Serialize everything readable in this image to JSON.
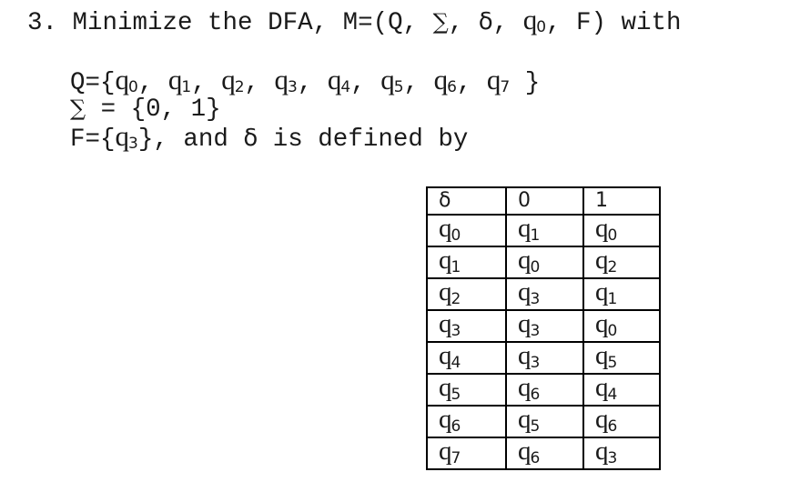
{
  "problem": {
    "number": "3.",
    "title_prefix": "Minimize the DFA, M=(Q, ",
    "sigma_symbol": "∑",
    "title_mid1": ", ",
    "delta_symbol": "δ",
    "title_mid2": ", ",
    "start_state": {
      "base": "q",
      "sub": "0"
    },
    "title_suffix": ", F) with"
  },
  "definitions": {
    "Q_label": "Q={",
    "states": [
      {
        "base": "q",
        "sub": "0"
      },
      {
        "base": "q",
        "sub": "1"
      },
      {
        "base": "q",
        "sub": "2"
      },
      {
        "base": "q",
        "sub": "3"
      },
      {
        "base": "q",
        "sub": "4"
      },
      {
        "base": "q",
        "sub": "5"
      },
      {
        "base": "q",
        "sub": "6"
      },
      {
        "base": "q",
        "sub": "7"
      }
    ],
    "Q_close": " }",
    "sigma_symbol": "∑",
    "sigma_rest": " = {0, 1}",
    "F_label": "F={",
    "final_states": [
      {
        "base": "q",
        "sub": "3"
      }
    ],
    "F_close": "}, and ",
    "delta_symbol": "δ",
    "F_rest": " is defined by"
  },
  "transition_table": {
    "headers": [
      "δ",
      "0",
      "1"
    ],
    "rows": [
      {
        "state": {
          "base": "q",
          "sub": "0"
        },
        "on0": {
          "base": "q",
          "sub": "1"
        },
        "on1": {
          "base": "q",
          "sub": "0"
        }
      },
      {
        "state": {
          "base": "q",
          "sub": "1"
        },
        "on0": {
          "base": "q",
          "sub": "0"
        },
        "on1": {
          "base": "q",
          "sub": "2"
        }
      },
      {
        "state": {
          "base": "q",
          "sub": "2"
        },
        "on0": {
          "base": "q",
          "sub": "3"
        },
        "on1": {
          "base": "q",
          "sub": "1"
        }
      },
      {
        "state": {
          "base": "q",
          "sub": "3"
        },
        "on0": {
          "base": "q",
          "sub": "3"
        },
        "on1": {
          "base": "q",
          "sub": "0"
        }
      },
      {
        "state": {
          "base": "q",
          "sub": "4"
        },
        "on0": {
          "base": "q",
          "sub": "3"
        },
        "on1": {
          "base": "q",
          "sub": "5"
        }
      },
      {
        "state": {
          "base": "q",
          "sub": "5"
        },
        "on0": {
          "base": "q",
          "sub": "6"
        },
        "on1": {
          "base": "q",
          "sub": "4"
        }
      },
      {
        "state": {
          "base": "q",
          "sub": "6"
        },
        "on0": {
          "base": "q",
          "sub": "5"
        },
        "on1": {
          "base": "q",
          "sub": "6"
        }
      },
      {
        "state": {
          "base": "q",
          "sub": "7"
        },
        "on0": {
          "base": "q",
          "sub": "6"
        },
        "on1": {
          "base": "q",
          "sub": "3"
        }
      }
    ]
  }
}
